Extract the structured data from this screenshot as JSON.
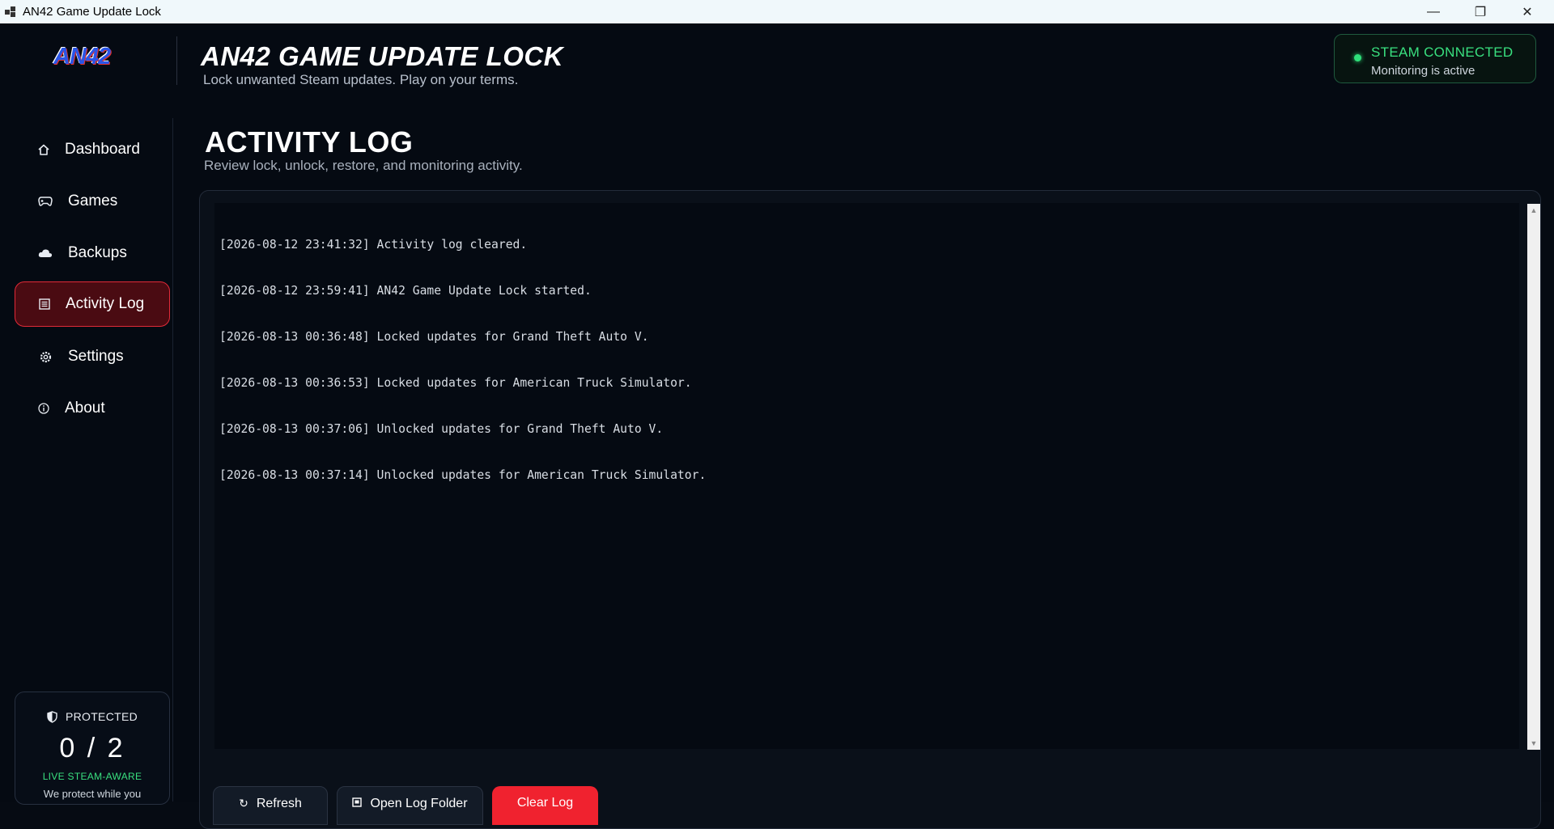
{
  "window": {
    "title": "AN42 Game Update Lock",
    "minimize": "—",
    "restore": "❐",
    "close": "✕"
  },
  "header": {
    "logo_text": "AN42",
    "title": "AN42 GAME UPDATE LOCK",
    "subtitle": "Lock unwanted Steam updates. Play on your terms."
  },
  "status": {
    "title": "STEAM CONNECTED",
    "detail": "Monitoring is active",
    "color": "#39e07f"
  },
  "sidebar": {
    "items": [
      {
        "label": "Dashboard",
        "icon": "home-icon"
      },
      {
        "label": "Games",
        "icon": "gamepad-icon"
      },
      {
        "label": "Backups",
        "icon": "cloud-icon"
      },
      {
        "label": "Activity Log",
        "icon": "list-icon",
        "active": true
      },
      {
        "label": "Settings",
        "icon": "gear-icon"
      },
      {
        "label": "About",
        "icon": "info-icon"
      }
    ],
    "protect": {
      "label": "PROTECTED",
      "count": "0 / 2",
      "live": "LIVE STEAM-AWARE",
      "tagline": "We protect while you"
    }
  },
  "page": {
    "title": "ACTIVITY LOG",
    "subtitle": "Review lock, unlock, restore, and monitoring activity."
  },
  "log": {
    "lines": [
      "[2026-08-12 23:41:32] Activity log cleared.",
      "[2026-08-12 23:59:41] AN42 Game Update Lock started.",
      "[2026-08-13 00:36:48] Locked updates for Grand Theft Auto V.",
      "[2026-08-13 00:36:53] Locked updates for American Truck Simulator.",
      "[2026-08-13 00:37:06] Unlocked updates for Grand Theft Auto V.",
      "[2026-08-13 00:37:14] Unlocked updates for American Truck Simulator."
    ]
  },
  "buttons": {
    "refresh": "Refresh",
    "open_folder": "Open Log Folder",
    "clear": "Clear Log"
  },
  "colors": {
    "accent_red": "#f0222f",
    "background": "#050a12"
  }
}
